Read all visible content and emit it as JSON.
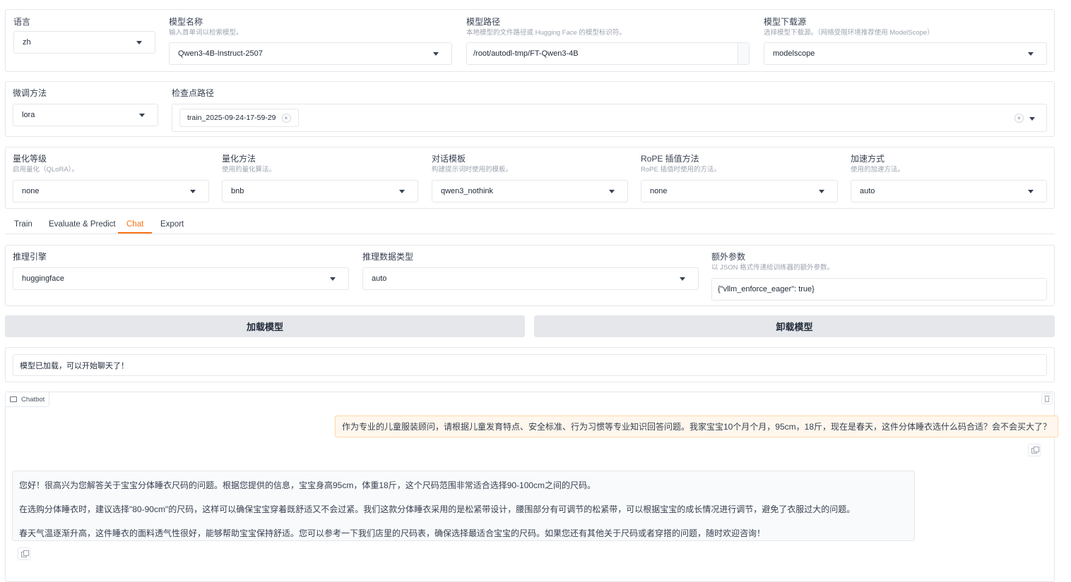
{
  "top": {
    "lang": {
      "label": "语言",
      "value": "zh"
    },
    "model_name": {
      "label": "模型名称",
      "info": "输入首单词以检索模型。",
      "value": "Qwen3-4B-Instruct-2507"
    },
    "model_path": {
      "label": "模型路径",
      "info": "本地模型的文件路径或 Hugging Face 的模型标识符。",
      "value": "/root/autodl-tmp/FT-Qwen3-4B"
    },
    "hub": {
      "label": "模型下载源",
      "info": "选择模型下载源。（网络受限环境推荐使用 ModelScope）",
      "value": "modelscope"
    }
  },
  "finetune": {
    "method": {
      "label": "微调方法",
      "value": "lora"
    },
    "checkpoint": {
      "label": "检查点路径",
      "chip": "train_2025-09-24-17-59-29",
      "remove_glyph": "×",
      "clear_glyph": "×"
    }
  },
  "advanced": {
    "quant_bit": {
      "label": "量化等级",
      "info": "启用量化（QLoRA）。",
      "value": "none"
    },
    "quant_method": {
      "label": "量化方法",
      "info": "使用的量化算法。",
      "value": "bnb"
    },
    "template": {
      "label": "对话模板",
      "info": "构建提示词时使用的模板。",
      "value": "qwen3_nothink"
    },
    "rope": {
      "label": "RoPE 插值方法",
      "info": "RoPE 插值时使用的方法。",
      "value": "none"
    },
    "booster": {
      "label": "加速方式",
      "info": "使用的加速方法。",
      "value": "auto"
    }
  },
  "tabs": [
    "Train",
    "Evaluate & Predict",
    "Chat",
    "Export"
  ],
  "active_tab": "Chat",
  "infer": {
    "backend": {
      "label": "推理引擎",
      "value": "huggingface"
    },
    "dtype": {
      "label": "推理数据类型",
      "value": "auto"
    },
    "extra": {
      "label": "额外参数",
      "info": "以 JSON 格式传递给训练器的额外参数。",
      "value": "{\"vllm_enforce_eager\": true}"
    }
  },
  "buttons": {
    "load": "加载模型",
    "unload": "卸载模型"
  },
  "status": "模型已加载，可以开始聊天了！",
  "chatbot": {
    "label": "Chatbot",
    "user_message": "作为专业的儿童服装顾问，请根据儿童发育特点、安全标准、行为习惯等专业知识回答问题。我家宝宝10个月个月，95cm，18斤，现在是春天，这件分体睡衣选什么码合适？会不会买大了？",
    "bot_paragraphs": [
      "您好！很高兴为您解答关于宝宝分体睡衣尺码的问题。根据您提供的信息，宝宝身高95cm，体重18斤，这个尺码范围非常适合选择90-100cm之间的尺码。",
      "在选购分体睡衣时，建议选择\"80-90cm\"的尺码，这样可以确保宝宝穿着既舒适又不会过紧。我们这款分体睡衣采用的是松紧带设计，腰围部分有可调节的松紧带，可以根据宝宝的成长情况进行调节，避免了衣服过大的问题。",
      "春天气温逐渐升高，这件睡衣的面料透气性很好，能够帮助宝宝保持舒适。您可以参考一下我们店里的尺码表，确保选择最适合宝宝的尺码。如果您还有其他关于尺码或者穿搭的问题，随时欢迎咨询！"
    ]
  }
}
